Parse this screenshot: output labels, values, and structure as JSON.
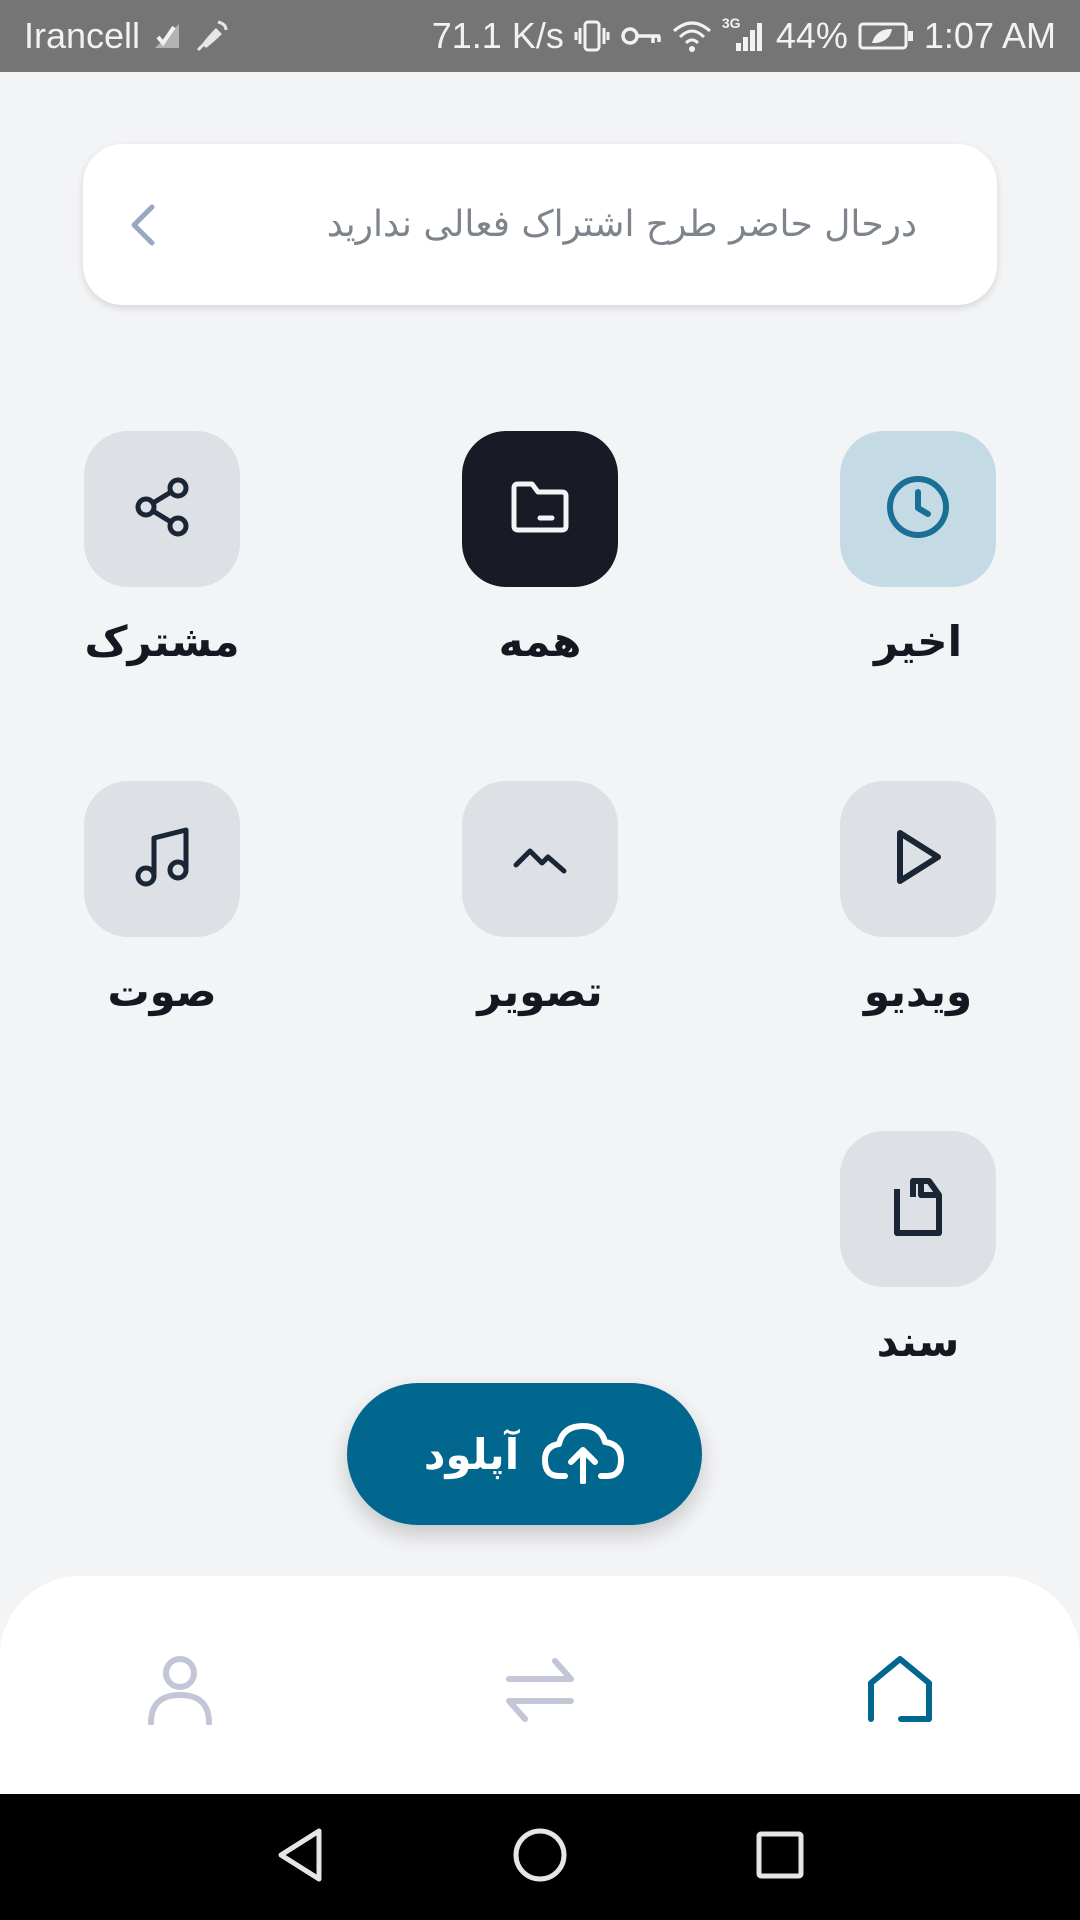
{
  "status_bar": {
    "carrier": "Irancell",
    "speed": "71.1 K/s",
    "network": "3G",
    "battery": "44%",
    "time": "1:07 AM"
  },
  "banner": {
    "text": "درحال حاضر طرح اشتراک فعالی ندارید",
    "icon": "chevron-left-icon"
  },
  "categories": [
    {
      "id": "recent",
      "label": "اخیر",
      "icon": "clock-icon",
      "selected": false
    },
    {
      "id": "all",
      "label": "همه",
      "icon": "folder-icon",
      "selected": true
    },
    {
      "id": "shared",
      "label": "مشترک",
      "icon": "share-icon",
      "selected": false
    },
    {
      "id": "video",
      "label": "ویدیو",
      "icon": "play-icon",
      "selected": false
    },
    {
      "id": "image",
      "label": "تصویر",
      "icon": "image-icon",
      "selected": false
    },
    {
      "id": "audio",
      "label": "صوت",
      "icon": "music-icon",
      "selected": false
    },
    {
      "id": "document",
      "label": "سند",
      "icon": "document-icon",
      "selected": false
    }
  ],
  "upload_button": {
    "label": "آپلود",
    "icon": "cloud-upload-icon"
  },
  "bottom_nav": [
    {
      "id": "home",
      "icon": "home-icon",
      "active": true
    },
    {
      "id": "transfer",
      "icon": "transfer-icon",
      "active": false
    },
    {
      "id": "profile",
      "icon": "user-icon",
      "active": false
    }
  ],
  "colors": {
    "background": "#f3f4f6",
    "accent": "#01678e",
    "tile": "#dde0e4",
    "tile_selected": "#191a25",
    "tile_recent": "#c4dbe5",
    "nav_inactive": "#c3c6d6"
  }
}
